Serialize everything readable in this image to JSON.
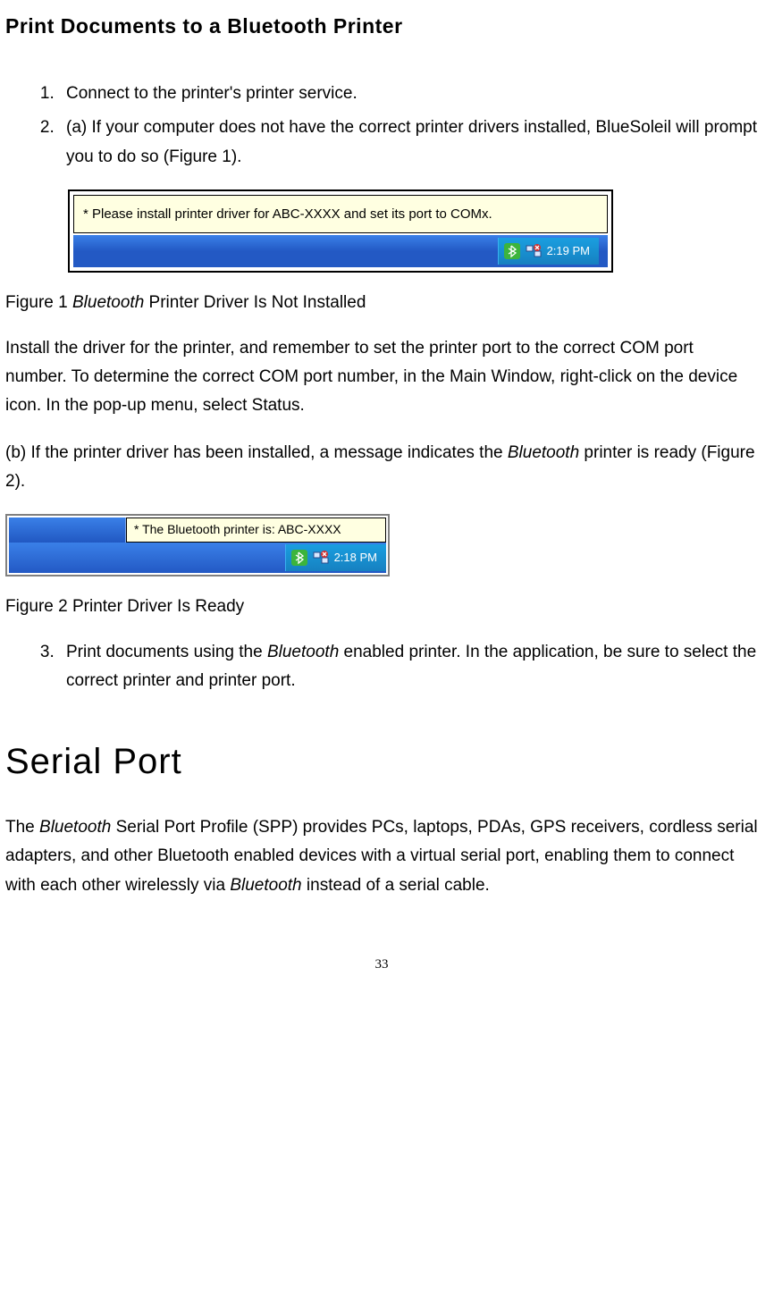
{
  "heading1": "Print Documents to a Bluetooth Printer",
  "steps_a": [
    "Connect to the printer's printer service.",
    "(a) If your computer does not have the correct printer drivers installed, BlueSoleil will prompt you to do so (Figure 1)."
  ],
  "fig1": {
    "tooltip": "* Please install printer driver for ABC-XXXX and set its port to COMx.",
    "clock": "2:19 PM"
  },
  "fig1_caption_pre": "Figure 1 ",
  "fig1_caption_italic": "Bluetooth",
  "fig1_caption_post": " Printer Driver Is Not Installed",
  "para1": "Install the driver for the printer, and remember to set the printer port to the correct COM port number. To determine the correct COM port number, in the Main Window, right-click on the device icon. In the pop-up menu, select Status.",
  "para2_pre": "(b) If the printer driver has been installed, a message indicates the ",
  "para2_italic": "Bluetooth",
  "para2_post": " printer is ready (Figure 2).",
  "fig2": {
    "tooltip": "* The Bluetooth printer is: ABC-XXXX",
    "clock": "2:18 PM"
  },
  "fig2_caption": "Figure 2 Printer Driver Is Ready",
  "step3_pre": "Print documents using the ",
  "step3_italic": "Bluetooth",
  "step3_post": " enabled printer. In the application, be sure to select the correct printer and printer port.",
  "heading2": "Serial Port",
  "para3_a": "The ",
  "para3_b": "Bluetooth",
  "para3_c": " Serial Port Profile (SPP) provides PCs, laptops, PDAs, GPS receivers, cordless serial adapters, and other Bluetooth enabled devices with a virtual serial port, enabling them to connect with each other wirelessly via ",
  "para3_d": "Bluetooth",
  "para3_e": " instead of a serial cable.",
  "page_number": "33"
}
